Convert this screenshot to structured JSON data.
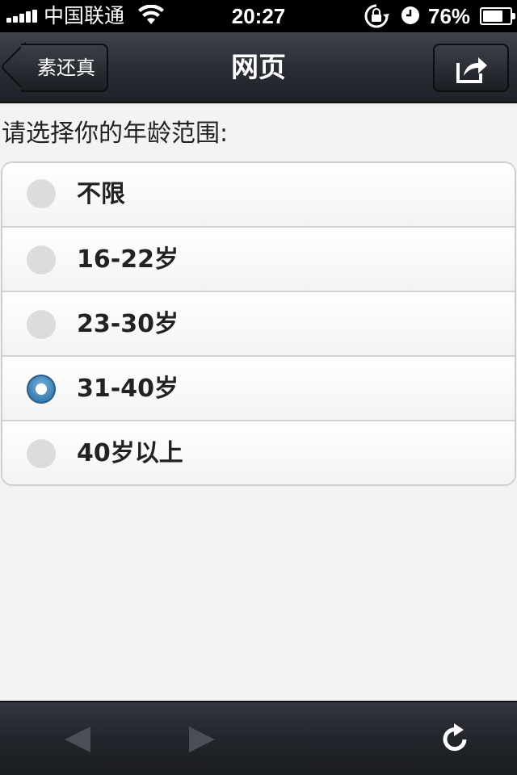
{
  "status_bar": {
    "carrier": "中国联通",
    "time": "20:27",
    "battery_percent": "76%",
    "battery_level": 0.76,
    "icons": [
      "signal-icon",
      "wifi-icon",
      "rotation-lock-icon",
      "alarm-clock-icon",
      "battery-icon"
    ]
  },
  "nav": {
    "back_label": "素还真",
    "title": "网页",
    "share_icon": "share-icon"
  },
  "form": {
    "prompt": "请选择你的年龄范围:",
    "options": [
      {
        "label": "不限",
        "selected": false
      },
      {
        "label": "16-22岁",
        "selected": false
      },
      {
        "label": "23-30岁",
        "selected": false
      },
      {
        "label": "31-40岁",
        "selected": true
      },
      {
        "label": "40岁以上",
        "selected": false
      }
    ]
  },
  "toolbar": {
    "icons": [
      "back-arrow-icon",
      "forward-arrow-icon",
      "reload-icon"
    ]
  },
  "colors": {
    "nav_bar": "#2c3037",
    "selected_radio": "#3d7fb2",
    "unselected_radio": "#dcdcdc"
  }
}
